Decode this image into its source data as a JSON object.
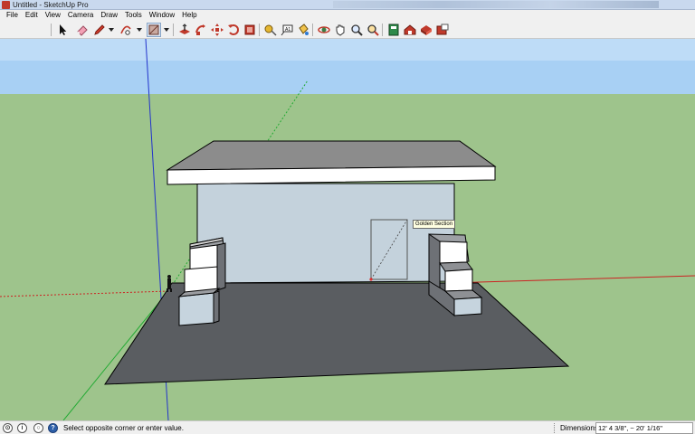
{
  "window": {
    "title": "Untitled - SketchUp Pro"
  },
  "menubar": {
    "items": [
      "File",
      "Edit",
      "View",
      "Camera",
      "Draw",
      "Tools",
      "Window",
      "Help"
    ]
  },
  "toolbar": {
    "tools": [
      "select",
      "eraser",
      "pencil",
      "arc",
      "rectangle",
      "push-pull",
      "follow-me",
      "move",
      "rotate",
      "scale",
      "offset",
      "tape-measure",
      "text",
      "protractor",
      "dimension",
      "orbit",
      "pan",
      "zoom",
      "zoom-extents",
      "warehouse",
      "component",
      "extension-warehouse",
      "layout"
    ],
    "active_tool": "rectangle"
  },
  "viewport": {
    "sky_color": "#a8d0f4",
    "ground_color": "#9ec48c",
    "tooltip": "Golden Section"
  },
  "statusbar": {
    "message": "Select opposite corner or enter value.",
    "measurement_label": "Dimensions",
    "measurement_value": "12' 4 3/8\", ~ 20' 1/16\""
  }
}
